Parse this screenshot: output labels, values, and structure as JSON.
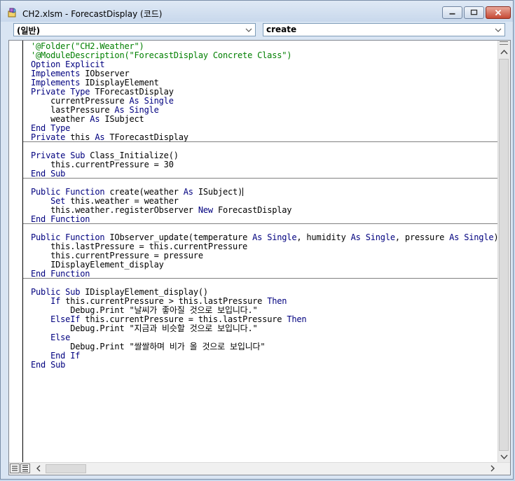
{
  "window": {
    "title": "CH2.xlsm - ForecastDisplay (코드)"
  },
  "object_combo": {
    "selected": "(일반)"
  },
  "procedure_combo": {
    "selected": "create"
  },
  "code_lines": {
    "l0": "'@Folder(\"CH2.Weather\")",
    "l1": "'@ModuleDescription(\"ForecastDisplay Concrete Class\")",
    "l2": [
      "Option Explicit",
      ""
    ],
    "l3": [
      "Implements",
      " IObserver"
    ],
    "l4": [
      "Implements",
      " IDisplayElement"
    ],
    "l5": [
      "Private Type",
      " TForecastDisplay"
    ],
    "l6": [
      "    currentPressure ",
      "As Single",
      ""
    ],
    "l7": [
      "    lastPressure ",
      "As Single",
      ""
    ],
    "l8": [
      "    weather ",
      "As",
      " ISubject"
    ],
    "l9": [
      "End Type",
      ""
    ],
    "l10": [
      "Private",
      " this ",
      "As",
      " TForecastDisplay"
    ],
    "l11": [
      "Private Sub",
      " Class_Initialize()"
    ],
    "l12": [
      "    this.currentPressure = 30"
    ],
    "l13": [
      "End Sub"
    ],
    "l14": [
      "Public Function",
      " create(weather ",
      "As",
      " ISubject)"
    ],
    "l15": [
      "    ",
      "Set",
      " this.weather = weather"
    ],
    "l16": [
      "    this.weather.registerObserver ",
      "New",
      " ForecastDisplay"
    ],
    "l17": [
      "End Function"
    ],
    "l18": [
      "Public Function",
      " IObserver_update(temperature ",
      "As Single",
      ", humidity ",
      "As Single",
      ", pressure ",
      "As Single",
      ")"
    ],
    "l19": [
      "    this.lastPressure = this.currentPressure"
    ],
    "l20": [
      "    this.currentPressure = pressure"
    ],
    "l21": [
      "    IDisplayElement_display"
    ],
    "l22": [
      "End Function"
    ],
    "l23": [
      "Public Sub",
      " IDisplayElement_display()"
    ],
    "l24": [
      "    ",
      "If",
      " this.currentPressure > this.lastPressure ",
      "Then"
    ],
    "l25": [
      "        Debug.Print \"날씨가 좋아질 것으로 보입니다.\""
    ],
    "l26": [
      "    ",
      "ElseIf",
      " this.currentPressure = this.lastPressure ",
      "Then"
    ],
    "l27": [
      "        Debug.Print \"지금과 비슷할 것으로 보입니다.\""
    ],
    "l28": [
      "    ",
      "Else"
    ],
    "l29": [
      "        Debug.Print \"쌀쌀하며 비가 올 것으로 보입니다\""
    ],
    "l30": [
      "    ",
      "End If"
    ],
    "l31": [
      "End Sub"
    ]
  },
  "colors": {
    "keyword": "#00007f",
    "comment": "#007f00",
    "text": "#000000"
  },
  "icons": {
    "app": "vba-module-icon",
    "minimize": "minimize-icon",
    "maximize": "maximize-icon",
    "close": "close-icon",
    "dropdown": "chevron-down-icon",
    "procedure_view": "procedure-view-icon",
    "full_module_view": "full-module-view-icon"
  }
}
